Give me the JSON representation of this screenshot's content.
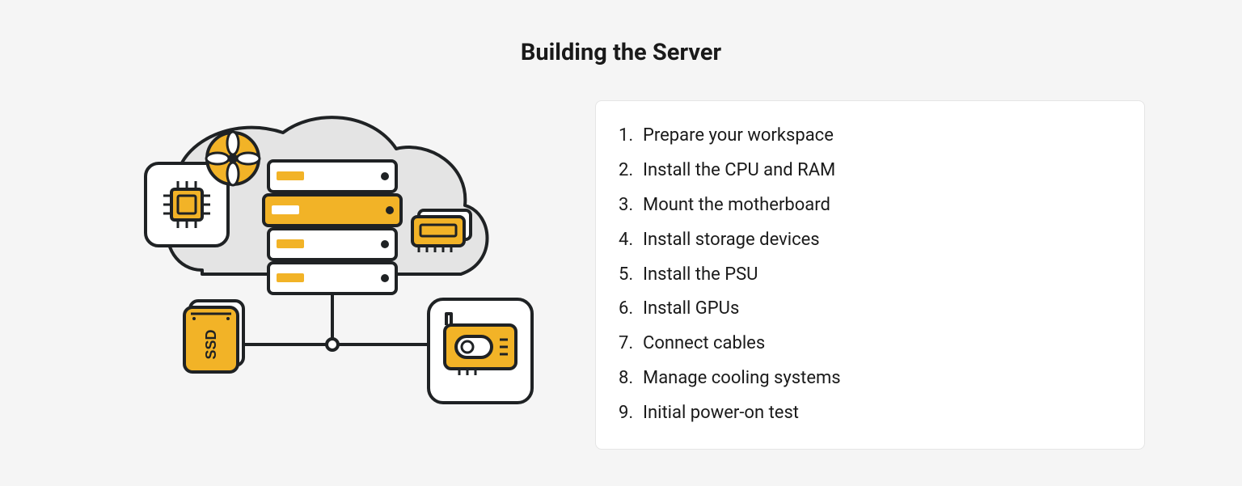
{
  "title": "Building the Server",
  "steps": [
    "Prepare your workspace",
    "Install the CPU and RAM",
    "Mount the motherboard",
    "Install storage devices",
    "Install the PSU",
    "Install GPUs",
    "Connect cables",
    "Manage cooling systems",
    "Initial power-on test"
  ],
  "illustration": {
    "ssd_label": "SSD",
    "colors": {
      "accent": "#F2B327",
      "stroke": "#1F2224",
      "cloud": "#E4E4E4",
      "white": "#FFFFFF"
    }
  }
}
